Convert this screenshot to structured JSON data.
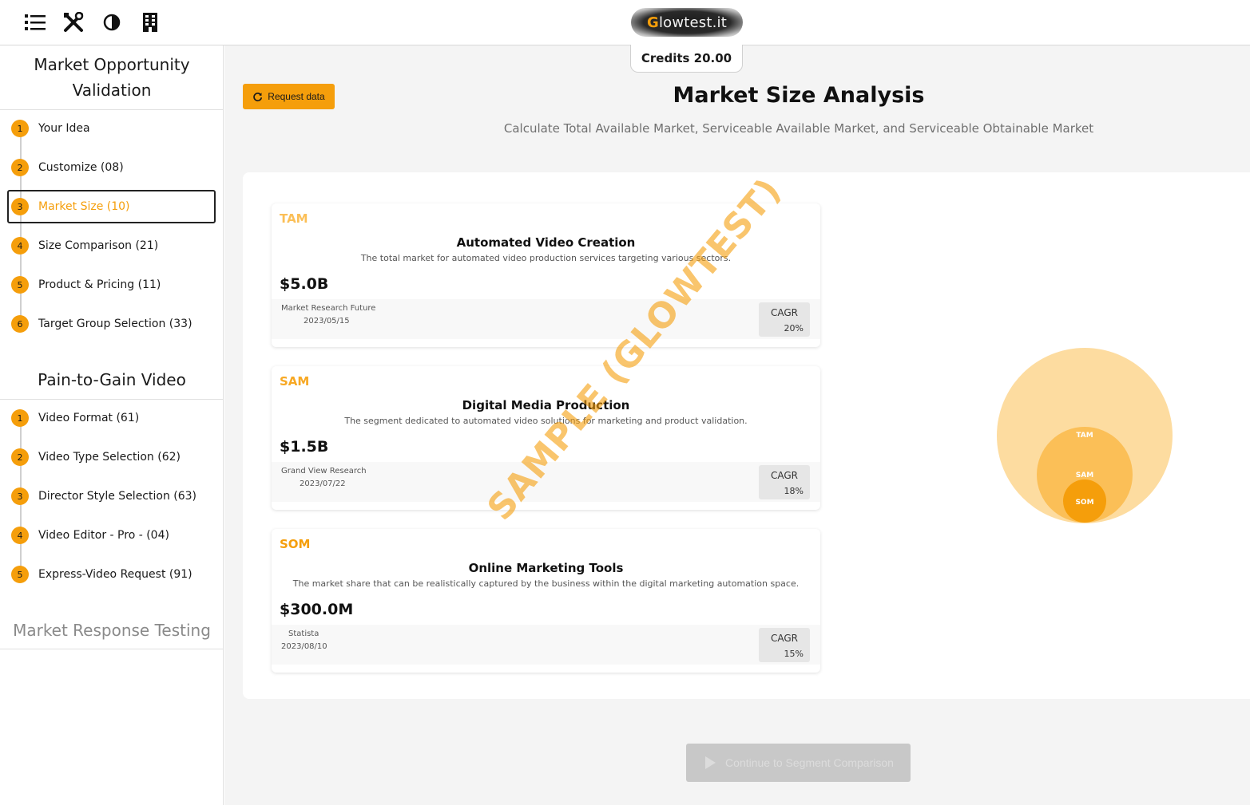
{
  "toolbar": {
    "icons": [
      "list-icon",
      "tools-icon",
      "contrast-icon",
      "building-icon"
    ]
  },
  "brand": {
    "logo_text": "Glowtest.it",
    "credits": "Credits 20.00"
  },
  "sidebar": {
    "sections": [
      {
        "title": "Market Opportunity Validation",
        "steps": [
          {
            "num": "1",
            "label": "Your Idea"
          },
          {
            "num": "2",
            "label": "Customize (08)"
          },
          {
            "num": "3",
            "label": "Market Size (10)",
            "active": true
          },
          {
            "num": "4",
            "label": "Size Comparison (21)"
          },
          {
            "num": "5",
            "label": "Product & Pricing (11)"
          },
          {
            "num": "6",
            "label": "Target Group Selection (33)"
          }
        ]
      },
      {
        "title": "Pain-to-Gain Video",
        "steps": [
          {
            "num": "1",
            "label": "Video Format (61)"
          },
          {
            "num": "2",
            "label": "Video Type Selection (62)"
          },
          {
            "num": "3",
            "label": "Director Style Selection (63)"
          },
          {
            "num": "4",
            "label": "Video Editor - Pro - (04)"
          },
          {
            "num": "5",
            "label": "Express-Video Request (91)"
          }
        ]
      },
      {
        "title": "Market Response Testing"
      }
    ]
  },
  "main": {
    "request_label": "Request data",
    "title": "Market Size Analysis",
    "subtitle": "Calculate Total Available Market, Serviceable Available Market, and Serviceable Obtainable Market",
    "cards": [
      {
        "tag": "TAM",
        "name": "Automated Video Creation",
        "description": "The total market for automated video production services targeting various sectors.",
        "value": "$5.0B",
        "source": "Market Research Future",
        "date": "2023/05/15",
        "cagr_label": "CAGR",
        "cagr": "20%"
      },
      {
        "tag": "SAM",
        "name": "Digital Media Production",
        "description": "The segment dedicated to automated video solutions for marketing and product validation.",
        "value": "$1.5B",
        "source": "Grand View Research",
        "date": "2023/07/22",
        "cagr_label": "CAGR",
        "cagr": "18%"
      },
      {
        "tag": "SOM",
        "name": "Online Marketing Tools",
        "description": "The market share that can be realistically captured by the business within the digital marketing automation space.",
        "value": "$300.0M",
        "source": "Statista",
        "date": "2023/08/10",
        "cagr_label": "CAGR",
        "cagr": "15%"
      }
    ],
    "watermark": "SAMPLE (GLOWTEST)",
    "continue_label": "Continue to Segment Comparison"
  },
  "diagram": {
    "labels": {
      "tam": "TAM",
      "sam": "SAM",
      "som": "SOM"
    },
    "colors": {
      "tam": "#fddca0",
      "sam": "#fbbf57",
      "som": "#f59e0b"
    }
  },
  "colors": {
    "accent": "#f59e0b",
    "tam_tag": "#fbbf57",
    "sam_tag": "#f7a823",
    "som_tag": "#f59e0b"
  }
}
